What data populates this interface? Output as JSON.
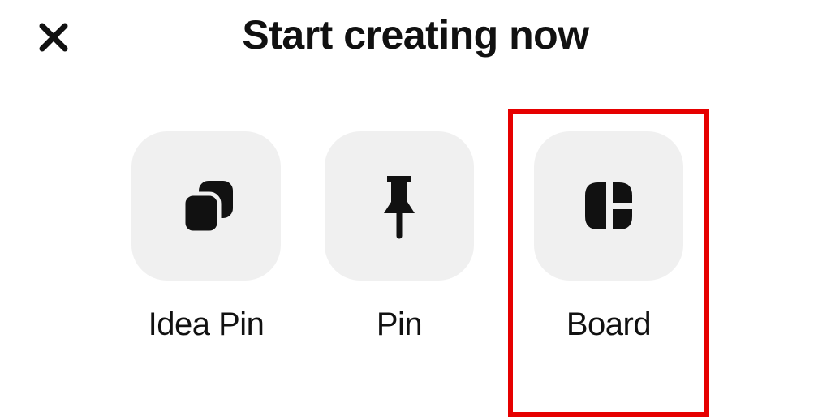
{
  "header": {
    "title": "Start creating now",
    "close_icon": "close"
  },
  "options": {
    "idea_pin": {
      "label": "Idea Pin",
      "icon": "idea-pin"
    },
    "pin": {
      "label": "Pin",
      "icon": "pin"
    },
    "board": {
      "label": "Board",
      "icon": "board",
      "highlighted": true
    }
  },
  "colors": {
    "highlight_border": "#e60000",
    "option_bg": "#f0f0f0",
    "icon_fill": "#111111"
  }
}
